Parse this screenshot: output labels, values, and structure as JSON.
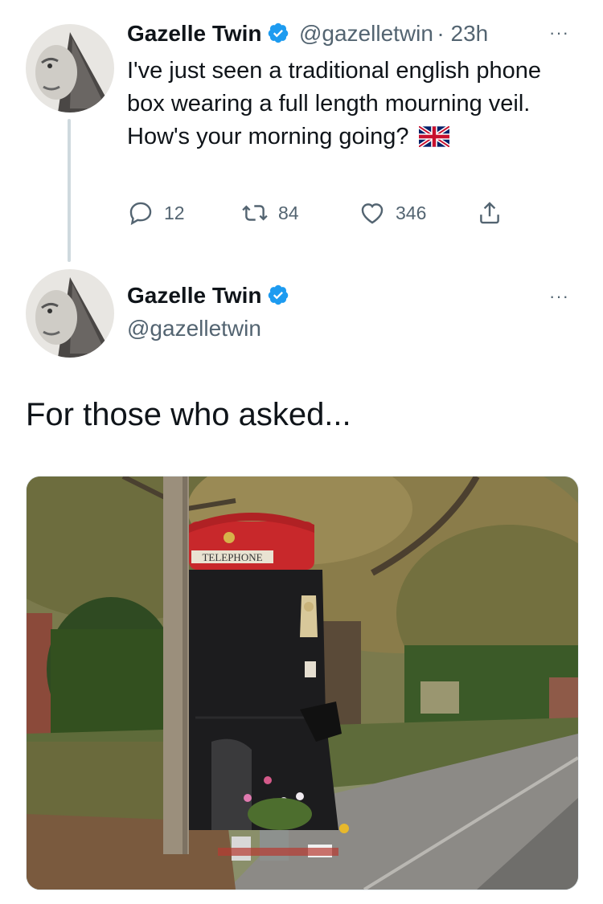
{
  "tweet1": {
    "name": "Gazelle Twin",
    "handle": "@gazelletwin",
    "time": "· 23h",
    "more": "···",
    "text": "I've just seen a traditional english phone box wearing a full length mourning veil. How's your morning going?",
    "actions": {
      "replies": "12",
      "retweets": "84",
      "likes": "346"
    }
  },
  "tweet2": {
    "name": "Gazelle Twin",
    "handle": "@gazelletwin",
    "more": "···",
    "text": "For those who asked...",
    "image": {
      "sign_text": "TELEPHONE"
    }
  },
  "colors": {
    "verified": "#1d9bf0",
    "muted": "#536471",
    "thread_line": "#cfd9de",
    "phone_red": "#c8282b"
  }
}
